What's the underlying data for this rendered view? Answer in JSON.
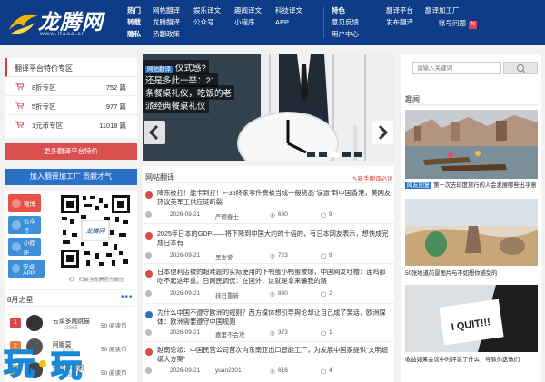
{
  "header": {
    "logo_text": "龙腾网",
    "logo_url": "www.ltaaa.cn",
    "nav_cols": [
      [
        "热门",
        "转载",
        "隐私"
      ],
      [
        "网帖翻译",
        "龙腾翻译",
        "热翻政策"
      ],
      [
        "娱乐译文",
        "公众号"
      ],
      [
        "趣闻译文",
        "小程序"
      ],
      [
        "科技译文",
        "APP"
      ],
      [
        "特色",
        "意见反馈",
        "用户中心"
      ],
      [
        "翻译平台",
        "发布翻译"
      ],
      [
        "翻译加工厂"
      ]
    ],
    "nav_head_flags": [
      true,
      false,
      false,
      false,
      false,
      true,
      false,
      false
    ],
    "feedback": "账号问题",
    "badge": "N"
  },
  "left": {
    "panel_title": "翻译平台特价专区",
    "zones": [
      {
        "label": "8折专区",
        "value": "752 篇"
      },
      {
        "label": "5折专区",
        "value": "977 篇"
      },
      {
        "label": "1元币专区",
        "value": "11018 篇"
      }
    ],
    "more_button": "更多翻译平台特价",
    "join_button": "加入翻译加工厂 贡献才气",
    "services": [
      {
        "label": "微博",
        "color": "#e85048"
      },
      {
        "label": "公众号",
        "color": "#3c8fd8"
      },
      {
        "label": "小程序",
        "color": "#3c8fd8"
      },
      {
        "label": "安卓APP",
        "color": "#3c8fd8"
      }
    ],
    "qr_caption": "扫一扫关注龙腾官方微信",
    "rank_title": "8月之星",
    "rank": [
      {
        "n": "1",
        "color": "#d84a4a",
        "name": "云菜多跳跳猫",
        "sub": "13365",
        "value": "50 阅读币"
      },
      {
        "n": "2",
        "color": "#e87a3c",
        "name": "阿娜莫",
        "sub": "6729",
        "value": "50 阅读币"
      },
      {
        "n": "3",
        "color": "#e8a23c",
        "name": "奶奶不喝粥",
        "sub": "6755",
        "value": "50 阅读币"
      }
    ]
  },
  "slider": {
    "tag": "网帖翻译",
    "caption_lines": [
      "仪式感?",
      "还是多此一举：21",
      "条餐桌礼仪，吃饭的老",
      "派经典餐桌礼仪"
    ]
  },
  "news": {
    "header": "网帖翻译",
    "new_link": "新手翻译必读",
    "items": [
      {
        "icon_color": "#d84a4a",
        "title": "降东被打！能卡到打！F-35终家零件费被当成一般货品\"误运\"到中国香港，美网友热议美军工供应链断裂",
        "date": "2026-09-21",
        "author": "严德春士",
        "views": "680",
        "comments": "9"
      },
      {
        "icon_color": "#d84a4a",
        "title": "2025年日本的GDP——将下降到中国大约的十倍的，有日本网友表示，想快成完成日本有",
        "date": "2026-09-21",
        "author": "黑发爱",
        "views": "723",
        "comments": "9"
      },
      {
        "icon_color": "#d84a4a",
        "title": "日本便利店被的超难题的实际使用的下鸭蛋小鸭蛋被爆，中国网友吐槽：连鸡都吃不起这年重。日网民调侃：在国外，这就是拿来骗我的路",
        "date": "2026-09-21",
        "author": "抹日重新",
        "views": "830",
        "comments": "2"
      },
      {
        "icon_color": "#2970c6",
        "title": "为什么中国不遵守欧洲的规则？西方媒体想引导舆论却让自己成了笑话，欧洲媒体：欧洲需要遵守中国规则",
        "date": "2026-09-21",
        "author": "嘉里不会攻",
        "views": "373",
        "comments": "1"
      },
      {
        "icon_color": "#d84a4a",
        "title": "越南论坛：中国民营公司首次向东南亚出口智能工厂，为发展中国家提供\"文明超级大方案\"",
        "date": "2026-09-21",
        "author": "yuan2301",
        "views": "616",
        "comments": "4"
      }
    ]
  },
  "right": {
    "search_placeholder": "请输入关键词",
    "section_title": "趣闻",
    "pics": [
      {
        "tag": "网友回复",
        "caption": "第一次去印度旅行的人会发展哪些出乎意"
      },
      {
        "tag": "",
        "caption": "50张地道前景图片与不如想你感受的"
      },
      {
        "tag": "",
        "caption": "收益如果会议中时评论了什么，导致你这做们"
      }
    ]
  }
}
